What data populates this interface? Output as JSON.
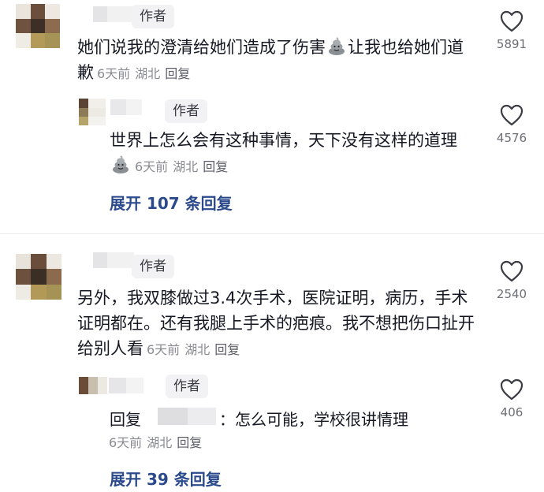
{
  "comments": [
    {
      "author_tag": "作者",
      "text": "她们说我的澄清给她们造成了伤害",
      "text_after_emoji": "让我也给她们道歉",
      "time": "6天前",
      "location": "湖北",
      "reply_label": "回复",
      "likes": "5891",
      "reply": {
        "author_tag": "作者",
        "text": "世界上怎么会有这种事情，天下没有这样的道理",
        "time": "6天前",
        "location": "湖北",
        "reply_label": "回复",
        "likes": "4576"
      },
      "expand_label": "展开 107 条回复"
    },
    {
      "author_tag": "作者",
      "text": "另外，我双膝做过3.4次手术，医院证明，病历，手术证明都在。还有我腿上手术的疤痕。我不想把伤口扯开给别人看",
      "time": "6天前",
      "location": "湖北",
      "reply_label": "回复",
      "likes": "2540",
      "reply": {
        "author_tag": "作者",
        "reply_prefix": "回复",
        "text": "：怎么可能，学校很讲情理",
        "time": "6天前",
        "location": "湖北",
        "reply_label": "回复",
        "likes": "406"
      },
      "expand_label": "展开 39 条回复"
    }
  ],
  "icons": {
    "like": "heart-outline-icon",
    "emoji": "poop-emoji-icon"
  },
  "colors": {
    "text": "#161823",
    "meta": "#8a8b91",
    "expand": "#2b4a8b",
    "tag_bg": "#f2f2f4"
  }
}
